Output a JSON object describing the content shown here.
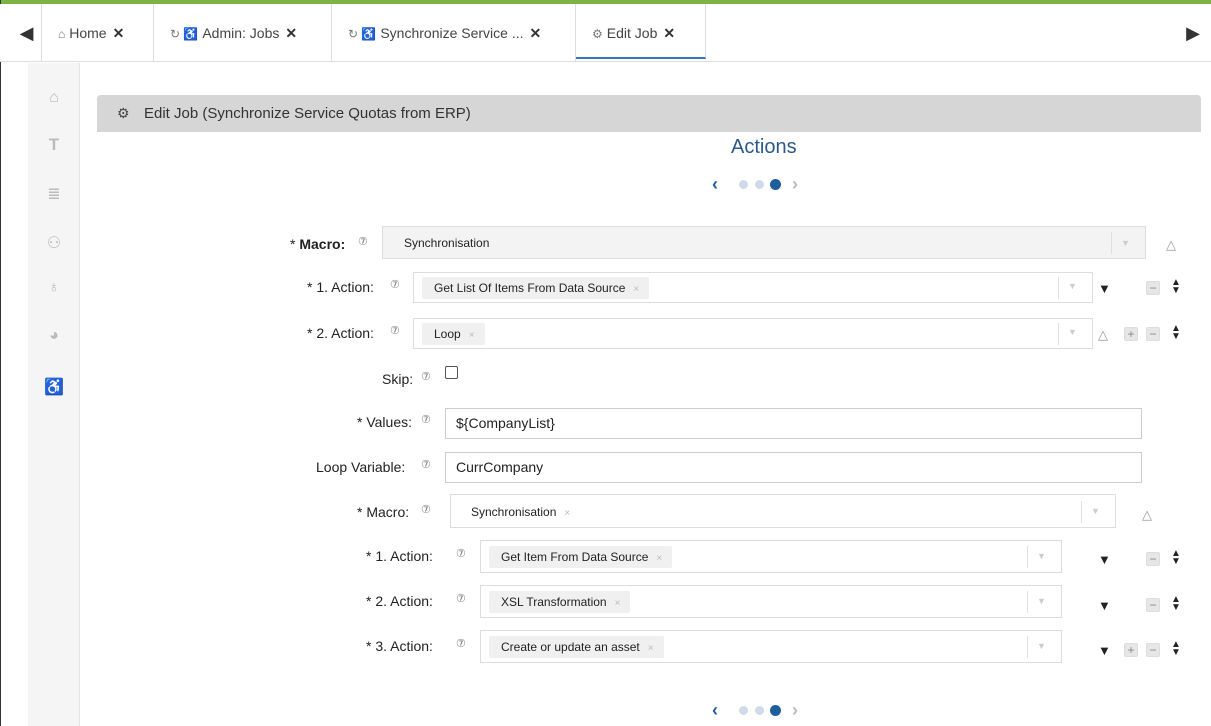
{
  "tabs": [
    {
      "label": "Home",
      "icon": "home-icon"
    },
    {
      "label": "Admin: Jobs",
      "icon": "refresh-icon"
    },
    {
      "label": "Synchronize Service ...",
      "icon": "refresh-icon"
    },
    {
      "label": "Edit Job",
      "icon": "gear-icon",
      "active": true
    }
  ],
  "panel": {
    "title": "Edit Job (Synchronize Service Quotas from ERP)"
  },
  "section_title": "Actions",
  "form": {
    "macro_label": "Macro:",
    "macro_value": "Synchronisation",
    "action1_label": "1. Action:",
    "action1_value": "Get List Of Items From Data Source",
    "action2_label": "2. Action:",
    "action2_value": "Loop",
    "skip_label": "Skip:",
    "values_label": "Values:",
    "values_value": "${CompanyList}",
    "loopvar_label": "Loop Variable:",
    "loopvar_value": "CurrCompany",
    "inner_macro_label": "Macro:",
    "inner_macro_value": "Synchronisation",
    "inner_action1_label": "1. Action:",
    "inner_action1_value": "Get Item From Data Source",
    "inner_action2_label": "2. Action:",
    "inner_action2_value": "XSL Transformation",
    "inner_action3_label": "3. Action:",
    "inner_action3_value": "Create or update an asset"
  },
  "colors": {
    "accent": "#7cb342",
    "title_blue": "#2b5a8a",
    "pager_active": "#1f5e9c"
  }
}
